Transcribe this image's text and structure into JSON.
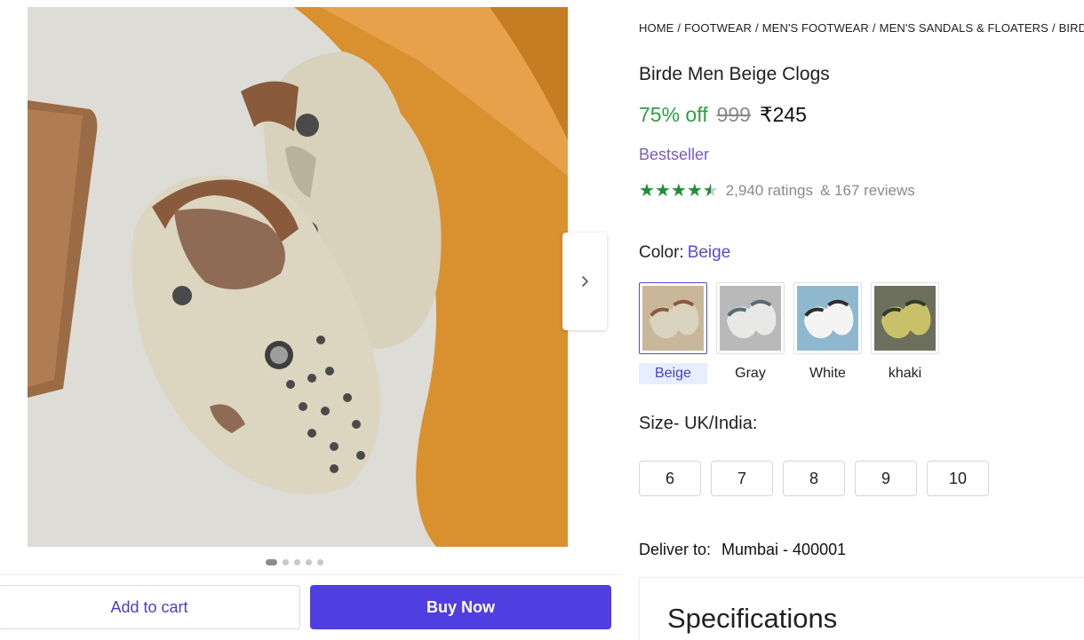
{
  "breadcrumb": [
    "HOME",
    "FOOTWEAR",
    "MEN'S FOOTWEAR",
    "MEN'S SANDALS & FLOATERS",
    "BIRDE ME"
  ],
  "product": {
    "title": "Birde Men Beige Clogs",
    "discount": "75% off",
    "mrp": "999",
    "price": "₹245",
    "badge": "Bestseller",
    "rating": 4.5,
    "ratings_text": "2,940 ratings",
    "reviews_text": "& 167 reviews"
  },
  "color": {
    "label": "Color:",
    "selected": "Beige",
    "options": [
      {
        "name": "Beige",
        "shoe": "#d9d3bf",
        "strap": "#8a5a3c",
        "bg": "#c9b79a"
      },
      {
        "name": "Gray",
        "shoe": "#e8e8e6",
        "strap": "#556b75",
        "bg": "#b9b9b9"
      },
      {
        "name": "White",
        "shoe": "#f4f4f4",
        "strap": "#2e2e2e",
        "bg": "#8fb8cf"
      },
      {
        "name": "khaki",
        "shoe": "#c9c169",
        "strap": "#2e3b2b",
        "bg": "#6c6f5c"
      }
    ]
  },
  "size": {
    "label": "Size- UK/India:",
    "options": [
      "6",
      "7",
      "8",
      "9",
      "10"
    ]
  },
  "delivery": {
    "label": "Deliver to:",
    "location": "Mumbai - 400001"
  },
  "specifications": {
    "title": "Specifications"
  },
  "actions": {
    "add_to_cart": "Add to cart",
    "buy_now": "Buy Now"
  },
  "gallery": {
    "dot_count": 5,
    "active_dot": 0
  },
  "colors": {
    "accent": "#4f3ee0",
    "discount": "#2ea043",
    "badge": "#7b5cc0",
    "star": "#1f8f3a"
  }
}
